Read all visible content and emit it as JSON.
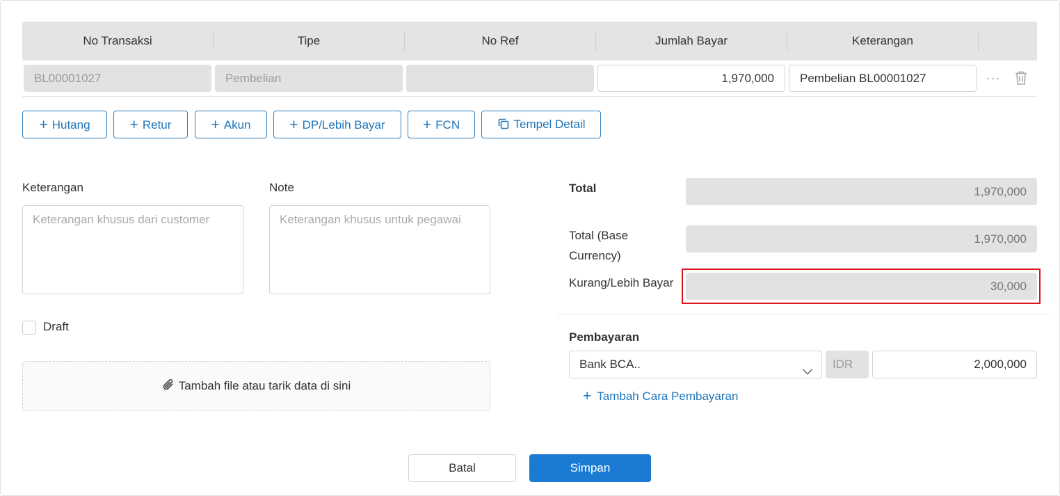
{
  "table": {
    "columns": [
      "No Transaksi",
      "Tipe",
      "No Ref",
      "Jumlah Bayar",
      "Keterangan"
    ],
    "row": {
      "no_transaksi": "BL00001027",
      "tipe": "Pembelian",
      "no_ref": "",
      "jumlah_bayar": "1,970,000",
      "keterangan": "Pembelian BL00001027",
      "more_glyph": "···"
    }
  },
  "add_buttons": {
    "hutang": "Hutang",
    "retur": "Retur",
    "akun": "Akun",
    "dp": "DP/Lebih Bayar",
    "fcn": "FCN",
    "tempel": "Tempel Detail",
    "plus_glyph": "+"
  },
  "form": {
    "keterangan_label": "Keterangan",
    "keterangan_placeholder": "Keterangan khusus dari customer",
    "note_label": "Note",
    "note_placeholder": "Keterangan khusus untuk pegawai",
    "draft_label": "Draft",
    "attach_text": "Tambah file atau tarik data di sini"
  },
  "summary": {
    "total_label": "Total",
    "total_value": "1,970,000",
    "total_base_label_1": "Total (Base",
    "total_base_label_2": "Currency)",
    "total_base_value": "1,970,000",
    "kurang_label": "Kurang/Lebih Bayar",
    "kurang_value": "30,000"
  },
  "payment": {
    "title": "Pembayaran",
    "method": "Bank BCA..",
    "currency": "IDR",
    "amount": "2,000,000",
    "add_label": "Tambah Cara Pembayaran"
  },
  "footer": {
    "cancel": "Batal",
    "save": "Simpan"
  },
  "colors": {
    "accent": "#1b7bd3",
    "highlight": "#d9141b"
  },
  "icons": {
    "trash": "trash-icon",
    "copy": "copy-icon",
    "paperclip": "paperclip-icon",
    "chevron": "chevron-down-icon",
    "more": "more-icon"
  }
}
